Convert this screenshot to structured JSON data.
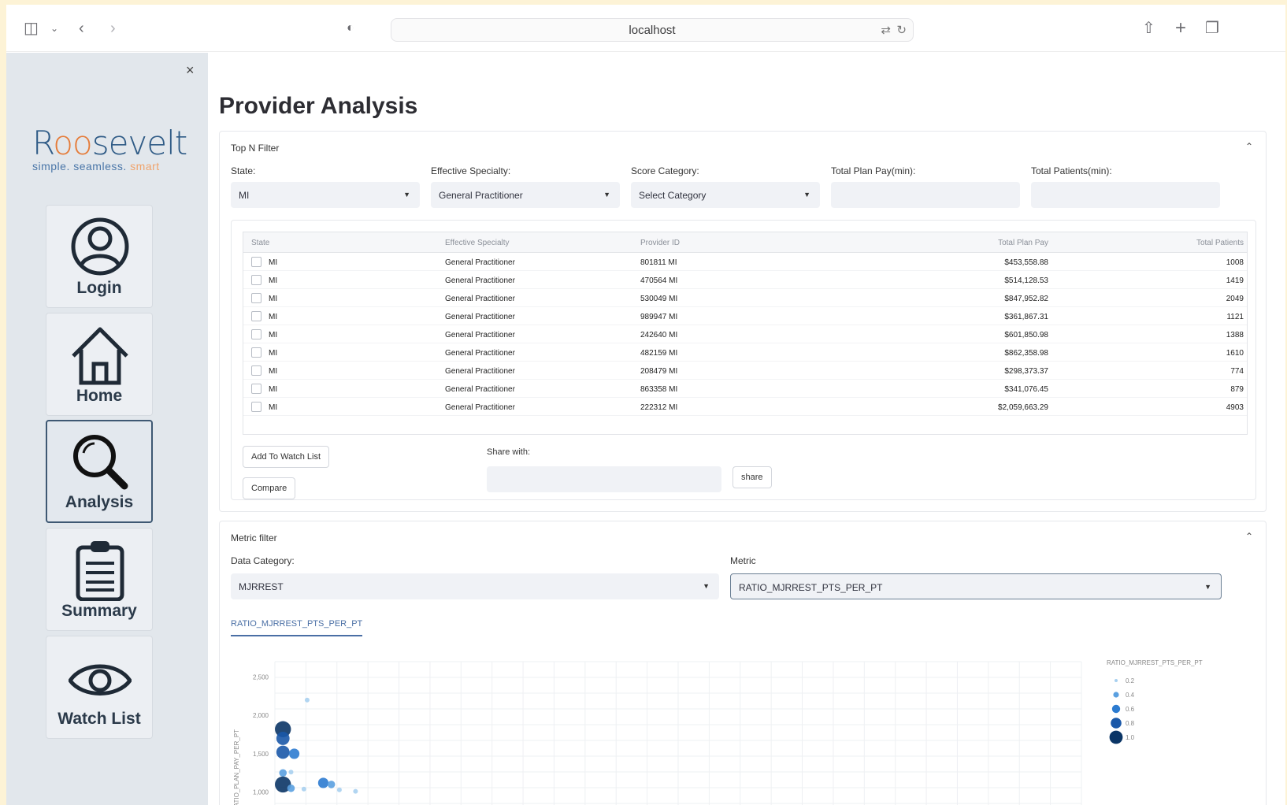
{
  "browser": {
    "url": "localhost"
  },
  "sidebar": {
    "close_label": "×",
    "logo": {
      "brand_pre": "R",
      "brand_oo": "oo",
      "brand_post": "sevelt",
      "tag_a": "simple. seamless.",
      "tag_b": "smart"
    },
    "nav": [
      {
        "label": "Login"
      },
      {
        "label": "Home"
      },
      {
        "label": "Analysis"
      },
      {
        "label": "Summary"
      },
      {
        "label": "Watch List"
      }
    ]
  },
  "page": {
    "title": "Provider Analysis"
  },
  "topn": {
    "title": "Top N Filter",
    "state_label": "State:",
    "state_value": "MI",
    "specialty_label": "Effective Specialty:",
    "specialty_value": "General Practitioner",
    "score_label": "Score Category:",
    "score_value": "Select Category",
    "planpay_label": "Total Plan Pay(min):",
    "patients_label": "Total Patients(min):",
    "table": {
      "headers": [
        "State",
        "Effective Specialty",
        "Provider ID",
        "Total Plan Pay",
        "Total Patients"
      ],
      "rows": [
        [
          "MI",
          "General Practitioner",
          "801811 MI",
          "$453,558.88",
          "1008"
        ],
        [
          "MI",
          "General Practitioner",
          "470564 MI",
          "$514,128.53",
          "1419"
        ],
        [
          "MI",
          "General Practitioner",
          "530049 MI",
          "$847,952.82",
          "2049"
        ],
        [
          "MI",
          "General Practitioner",
          "989947 MI",
          "$361,867.31",
          "1121"
        ],
        [
          "MI",
          "General Practitioner",
          "242640 MI",
          "$601,850.98",
          "1388"
        ],
        [
          "MI",
          "General Practitioner",
          "482159 MI",
          "$862,358.98",
          "1610"
        ],
        [
          "MI",
          "General Practitioner",
          "208479 MI",
          "$298,373.37",
          "774"
        ],
        [
          "MI",
          "General Practitioner",
          "863358 MI",
          "$341,076.45",
          "879"
        ],
        [
          "MI",
          "General Practitioner",
          "222312 MI",
          "$2,059,663.29",
          "4903"
        ]
      ]
    },
    "add_watch_label": "Add To Watch List",
    "compare_label": "Compare",
    "share_with_label": "Share with:",
    "share_label": "share"
  },
  "metric": {
    "title": "Metric filter",
    "category_label": "Data Category:",
    "category_value": "MJRREST",
    "metric_label": "Metric",
    "metric_value": "RATIO_MJRREST_PTS_PER_PT",
    "tab_label": "RATIO_MJRREST_PTS_PER_PT"
  },
  "chart_data": {
    "type": "scatter",
    "ylabel": "RATIO_PLAN_PAY_PER_PT",
    "y_ticks": [
      "2,500",
      "2,000",
      "1,500",
      "1,000"
    ],
    "legend_title": "RATIO_MJRREST_PTS_PER_PT",
    "legend": [
      "0.2",
      "0.4",
      "0.6",
      "0.8",
      "1.0"
    ],
    "colors": [
      "#a8d0f0",
      "#5aa0e0",
      "#2c7bd0",
      "#1a58a8",
      "#0b3566"
    ],
    "points": [
      {
        "x": 0.02,
        "y": 2200,
        "c": 0.2
      },
      {
        "x": 0.005,
        "y": 1820,
        "c": 1.0
      },
      {
        "x": 0.005,
        "y": 1700,
        "c": 0.8
      },
      {
        "x": 0.005,
        "y": 1520,
        "c": 0.8
      },
      {
        "x": 0.012,
        "y": 1500,
        "c": 0.6
      },
      {
        "x": 0.005,
        "y": 1250,
        "c": 0.4
      },
      {
        "x": 0.01,
        "y": 1260,
        "c": 0.2
      },
      {
        "x": 0.005,
        "y": 1100,
        "c": 1.0
      },
      {
        "x": 0.01,
        "y": 1050,
        "c": 0.4
      },
      {
        "x": 0.018,
        "y": 1040,
        "c": 0.2
      },
      {
        "x": 0.03,
        "y": 1120,
        "c": 0.6
      },
      {
        "x": 0.035,
        "y": 1100,
        "c": 0.4
      },
      {
        "x": 0.04,
        "y": 1030,
        "c": 0.2
      },
      {
        "x": 0.05,
        "y": 1010,
        "c": 0.2
      }
    ]
  }
}
